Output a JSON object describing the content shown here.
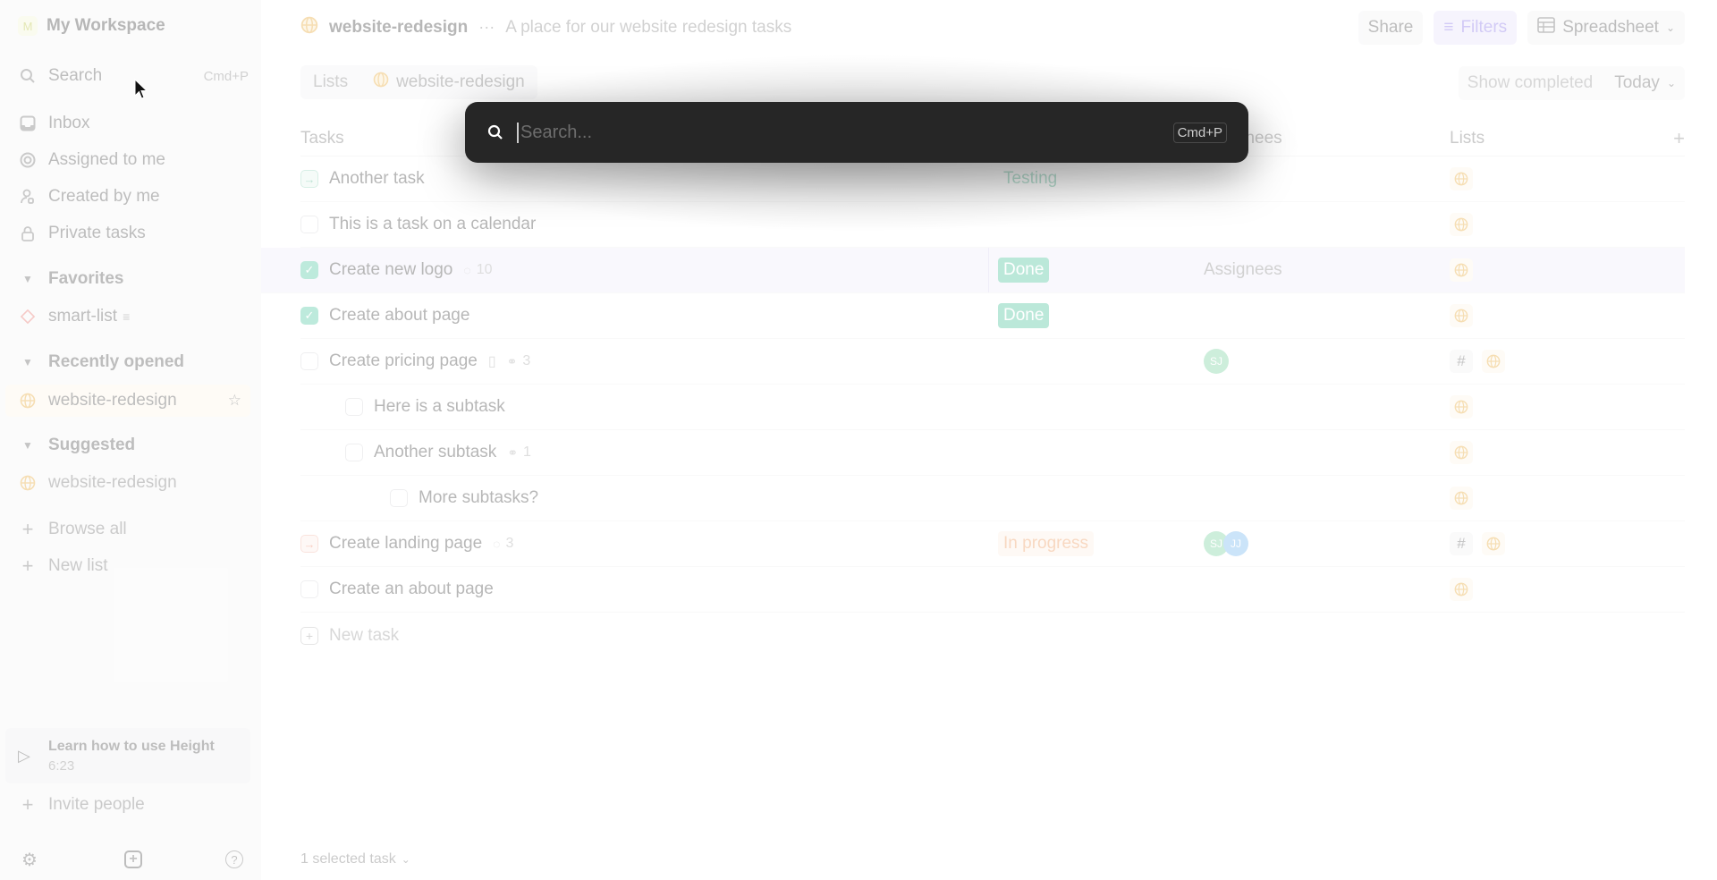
{
  "sidebar": {
    "workspace_initial": "M",
    "workspace_name": "My Workspace",
    "search_label": "Search",
    "search_shortcut": "Cmd+P",
    "nav": [
      {
        "label": "Inbox",
        "icon": "inbox-icon"
      },
      {
        "label": "Assigned to me",
        "icon": "target-icon"
      },
      {
        "label": "Created by me",
        "icon": "user-icon"
      },
      {
        "label": "Private tasks",
        "icon": "lock-icon"
      }
    ],
    "favorites": {
      "title": "Favorites",
      "items": [
        {
          "label": "smart-list",
          "icon": "diamond-icon"
        }
      ]
    },
    "recent": {
      "title": "Recently opened",
      "items": [
        {
          "label": "website-redesign",
          "icon": "globe-icon"
        }
      ]
    },
    "suggested": {
      "title": "Suggested",
      "items": [
        {
          "label": "website-redesign",
          "icon": "globe-icon"
        }
      ]
    },
    "browse_all": "Browse all",
    "new_list": "New list",
    "learn_title": "Learn how to use Height",
    "learn_duration": "6:23",
    "invite": "Invite people"
  },
  "header": {
    "list_name": "website-redesign",
    "description": "A place for our website redesign tasks",
    "share": "Share",
    "filters": "Filters",
    "view": "Spreadsheet",
    "chips_label": "Lists",
    "chips_value": "website-redesign",
    "show_completed": "Show completed",
    "today": "Today"
  },
  "table": {
    "columns": {
      "tasks": "Tasks",
      "assignees": "Assignees",
      "lists": "Lists"
    },
    "rows": [
      {
        "name": "Another task",
        "state": "arrow-g",
        "status": "Testing",
        "status_kind": "testing",
        "meta": "",
        "assignees": [],
        "hash": false,
        "indent": 0
      },
      {
        "name": "This is a task on a calendar",
        "state": "empty",
        "status": "",
        "status_kind": "",
        "meta": "",
        "assignees": [],
        "hash": false,
        "indent": 0
      },
      {
        "name": "Create new logo",
        "state": "done",
        "status": "Done",
        "status_kind": "done",
        "meta_icon": "comment-icon",
        "meta": "10",
        "assignee_placeholder": "Assignees",
        "assignees": [],
        "hash": false,
        "indent": 0,
        "selected": true
      },
      {
        "name": "Create about page",
        "state": "done",
        "status": "Done",
        "status_kind": "done",
        "meta": "",
        "assignees": [],
        "hash": false,
        "indent": 0
      },
      {
        "name": "Create pricing page",
        "state": "empty",
        "status": "",
        "status_kind": "",
        "meta_icon": "subtask-icon",
        "meta": "3",
        "has_doc": true,
        "assignees": [
          "SJ"
        ],
        "hash": true,
        "indent": 0
      },
      {
        "name": "Here is a subtask",
        "state": "empty",
        "status": "",
        "status_kind": "",
        "meta": "",
        "assignees": [],
        "hash": false,
        "indent": 1
      },
      {
        "name": "Another subtask",
        "state": "empty",
        "status": "",
        "status_kind": "",
        "meta_icon": "subtask-icon",
        "meta": "1",
        "assignees": [],
        "hash": false,
        "indent": 1
      },
      {
        "name": "More subtasks?",
        "state": "empty",
        "status": "",
        "status_kind": "",
        "meta": "",
        "assignees": [],
        "hash": false,
        "indent": 2
      },
      {
        "name": "Create landing page",
        "state": "arrow-o",
        "status": "In progress",
        "status_kind": "progress",
        "meta_icon": "comment-icon",
        "meta": "3",
        "assignees": [
          "SJ",
          "JJ"
        ],
        "hash": true,
        "indent": 0
      },
      {
        "name": "Create an about page",
        "state": "empty",
        "status": "",
        "status_kind": "",
        "meta": "",
        "assignees": [],
        "hash": false,
        "indent": 0
      }
    ],
    "new_task": "New task"
  },
  "footer": {
    "selected": "1 selected task"
  },
  "palette": {
    "placeholder": "Search...",
    "value": "",
    "shortcut": "Cmd+P"
  }
}
